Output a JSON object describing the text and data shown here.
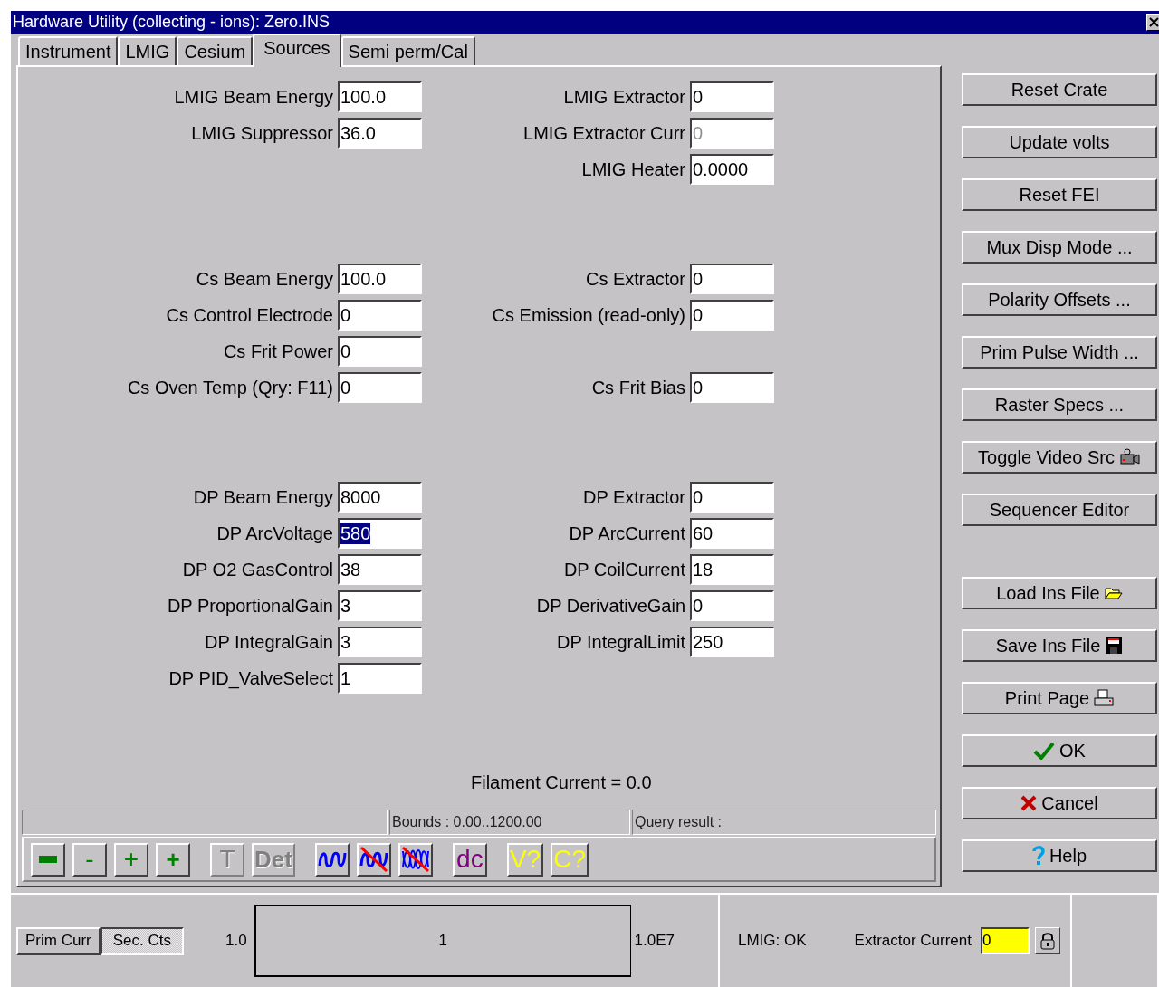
{
  "window": {
    "title": "Hardware Utility (collecting - ions): Zero.INS"
  },
  "tabs": [
    {
      "label": "Instrument",
      "selected": false
    },
    {
      "label": "LMIG",
      "selected": false
    },
    {
      "label": "Cesium",
      "selected": false
    },
    {
      "label": "Sources",
      "selected": true
    },
    {
      "label": "Semi perm/Cal",
      "selected": false
    }
  ],
  "groups": [
    {
      "rows": [
        {
          "left": {
            "label": "LMIG Beam Energy",
            "value": "100.0",
            "disabled": false,
            "selected": false
          },
          "right": {
            "label": "LMIG Extractor",
            "value": "0",
            "disabled": false,
            "selected": false
          }
        },
        {
          "left": {
            "label": "LMIG Suppressor",
            "value": "36.0",
            "disabled": false,
            "selected": false
          },
          "right": {
            "label": "LMIG Extractor Curr",
            "value": "0",
            "disabled": true,
            "selected": false
          }
        },
        {
          "right": {
            "label": "LMIG Heater",
            "value": "0.0000",
            "disabled": false,
            "selected": false
          }
        }
      ]
    },
    {
      "rows": [
        {
          "left": {
            "label": "Cs Beam Energy",
            "value": "100.0",
            "disabled": false,
            "selected": false
          },
          "right": {
            "label": "Cs Extractor",
            "value": "0",
            "disabled": false,
            "selected": false
          }
        },
        {
          "left": {
            "label": "Cs Control Electrode",
            "value": "0",
            "disabled": false,
            "selected": false
          },
          "right": {
            "label": "Cs Emission (read-only)",
            "value": "0",
            "disabled": false,
            "selected": false
          }
        },
        {
          "left": {
            "label": "Cs Frit Power",
            "value": "0",
            "disabled": false,
            "selected": false
          }
        },
        {
          "left": {
            "label": "Cs Oven Temp (Qry: F11)",
            "value": "0",
            "disabled": false,
            "selected": false
          },
          "right": {
            "label": "Cs Frit Bias",
            "value": "0",
            "disabled": false,
            "selected": false
          }
        }
      ]
    },
    {
      "rows": [
        {
          "left": {
            "label": "DP Beam Energy",
            "value": "8000",
            "disabled": false,
            "selected": false
          },
          "right": {
            "label": "DP Extractor",
            "value": "0",
            "disabled": false,
            "selected": false
          }
        },
        {
          "left": {
            "label": "DP ArcVoltage",
            "value": "580",
            "disabled": false,
            "selected": true
          },
          "right": {
            "label": "DP ArcCurrent",
            "value": "60",
            "disabled": false,
            "selected": false
          }
        },
        {
          "left": {
            "label": "DP O2 GasControl",
            "value": "38",
            "disabled": false,
            "selected": false
          },
          "right": {
            "label": "DP CoilCurrent",
            "value": "18",
            "disabled": false,
            "selected": false
          }
        },
        {
          "left": {
            "label": "DP ProportionalGain",
            "value": "3",
            "disabled": false,
            "selected": false
          },
          "right": {
            "label": "DP DerivativeGain",
            "value": "0",
            "disabled": false,
            "selected": false
          }
        },
        {
          "left": {
            "label": "DP IntegralGain",
            "value": "3",
            "disabled": false,
            "selected": false
          },
          "right": {
            "label": "DP IntegralLimit",
            "value": "250",
            "disabled": false,
            "selected": false
          }
        },
        {
          "left": {
            "label": "DP PID_ValveSelect",
            "value": "1",
            "disabled": false,
            "selected": false
          }
        }
      ]
    }
  ],
  "filament_current": "Filament Current = 0.0",
  "status": {
    "bounds": "Bounds : 0.00..1200.00",
    "query": "Query result :"
  },
  "toolbar": [
    [
      {
        "kind": "bar",
        "color": "#008000",
        "disabled": false
      },
      {
        "kind": "text",
        "label": "-",
        "color": "#008000",
        "disabled": false
      },
      {
        "kind": "text",
        "label": "+",
        "color": "#008000",
        "disabled": false
      },
      {
        "kind": "bold-text",
        "label": "+",
        "color": "#008000",
        "disabled": false
      }
    ],
    [
      {
        "kind": "text",
        "label": "T",
        "color": "#808080",
        "disabled": true
      },
      {
        "kind": "bold-text",
        "label": "Det",
        "color": "#808080",
        "disabled": true
      }
    ],
    [
      {
        "kind": "wave",
        "color": "#0000ff",
        "disabled": false
      },
      {
        "kind": "wave-crossed",
        "color": "#0000ff",
        "disabled": false
      },
      {
        "kind": "double-wave-crossed",
        "color": "#0000ff",
        "disabled": false
      }
    ],
    [
      {
        "kind": "text",
        "label": "dc",
        "color": "#800080",
        "disabled": false
      }
    ],
    [
      {
        "kind": "text",
        "label": "V?",
        "color": "#ffff00",
        "disabled": false
      },
      {
        "kind": "text",
        "label": "C?",
        "color": "#ffff00",
        "disabled": false
      }
    ]
  ],
  "side_buttons": [
    [
      {
        "label": "Reset Crate",
        "kind": "plain"
      },
      {
        "label": "Update volts",
        "kind": "plain"
      },
      {
        "label": "Reset FEI",
        "kind": "plain"
      },
      {
        "label": "Mux Disp Mode ...",
        "kind": "plain"
      },
      {
        "label": "Polarity Offsets ...",
        "kind": "plain"
      },
      {
        "label": "Prim Pulse Width ...",
        "kind": "plain"
      },
      {
        "label": "Raster Specs ...",
        "kind": "plain"
      },
      {
        "label": "Toggle Video Src",
        "kind": "camera"
      },
      {
        "label": "Sequencer Editor",
        "kind": "plain"
      }
    ],
    [
      {
        "label": "Load Ins File",
        "kind": "folder"
      },
      {
        "label": "Save Ins File",
        "kind": "floppy"
      },
      {
        "label": "Print Page",
        "kind": "printer"
      },
      {
        "label": "OK",
        "kind": "check"
      },
      {
        "label": "Cancel",
        "kind": "cross"
      },
      {
        "label": "Help",
        "kind": "help"
      }
    ]
  ],
  "bottom": {
    "modes": [
      {
        "label": "Prim Curr",
        "selected": false
      },
      {
        "label": "Sec. Cts",
        "selected": true
      }
    ],
    "scale_min": "1.0",
    "scale_value": "1",
    "scale_max": "1.0E7",
    "lmig_status": "LMIG: OK",
    "extractor_label": "Extractor Current",
    "extractor_value": "0"
  }
}
